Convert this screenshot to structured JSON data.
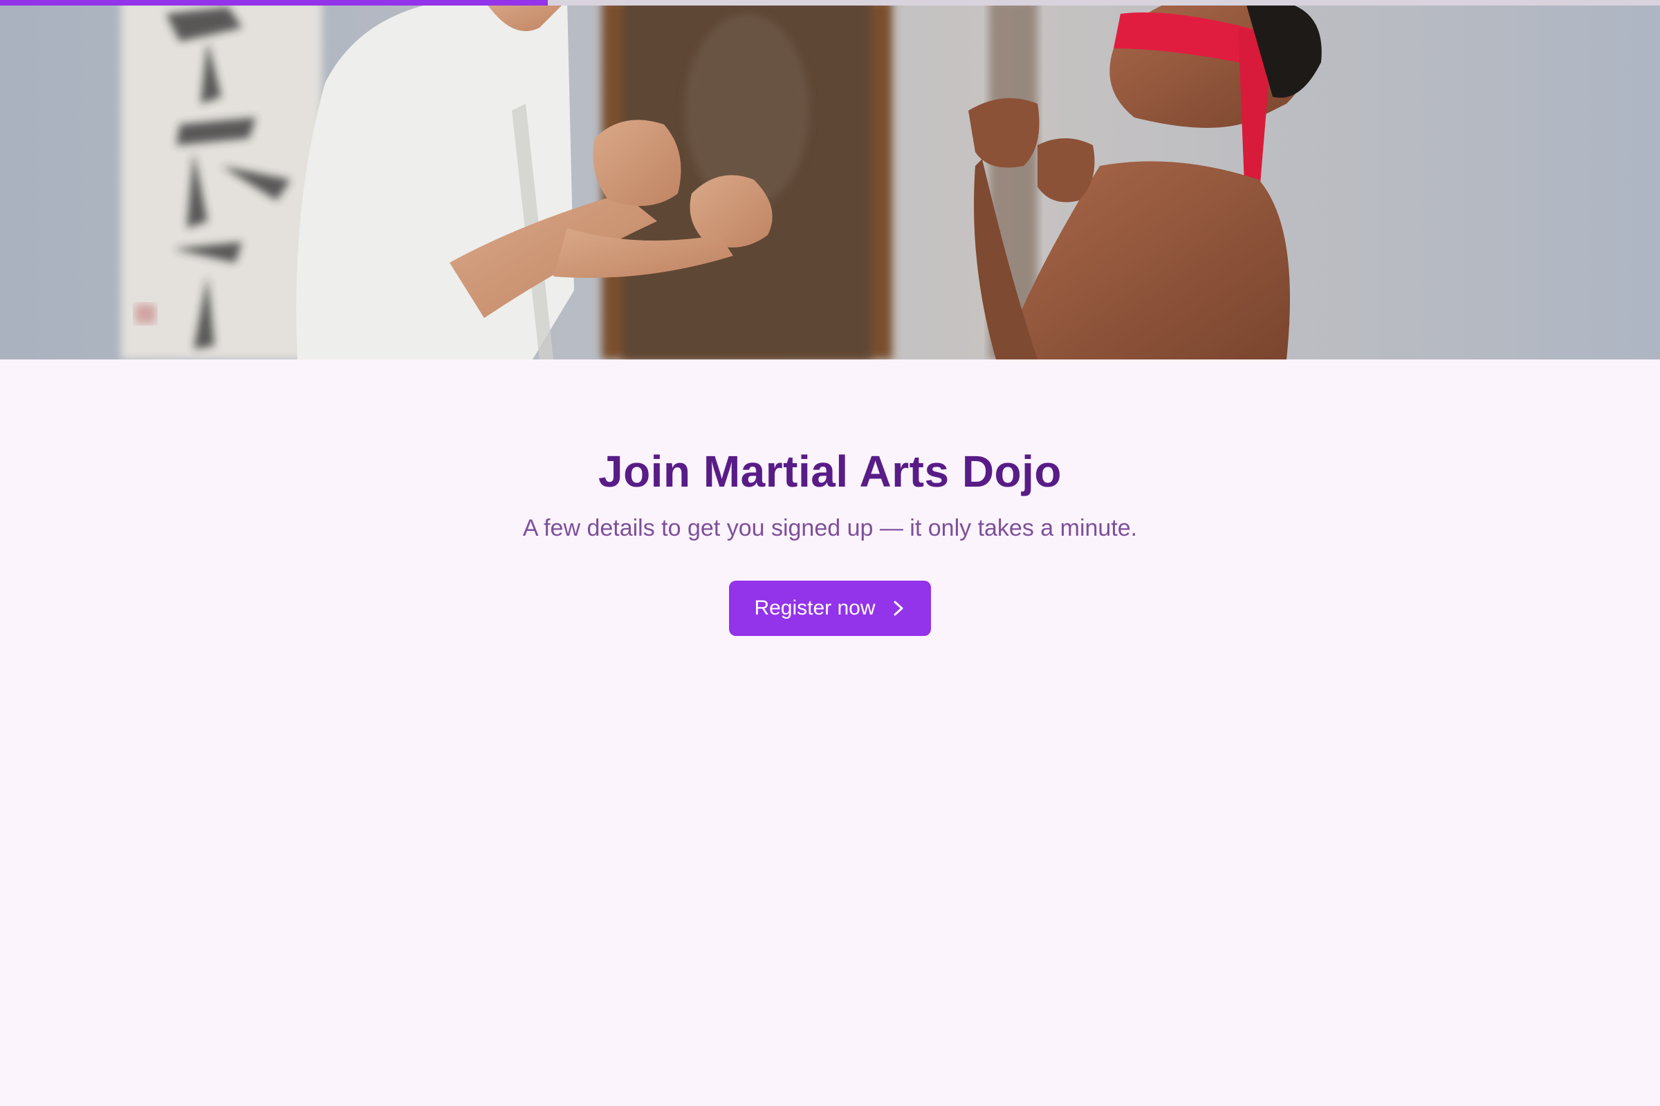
{
  "progress": {
    "value_percent": 33,
    "color": "#9333ea",
    "track_color": "#d9d3de"
  },
  "hero": {
    "description_icon": "photo",
    "alt": "Two martial arts students in fighting stance in a dojo"
  },
  "content": {
    "title": "Join Martial Arts Dojo",
    "subtitle": "A few details to get you signed up — it only takes a minute.",
    "cta_label": "Register now",
    "cta_icon": "chevron-right-icon"
  },
  "colors": {
    "background": "#fbf4fd",
    "title": "#581c87",
    "subtitle": "#7e4f9a",
    "accent": "#9333ea"
  }
}
